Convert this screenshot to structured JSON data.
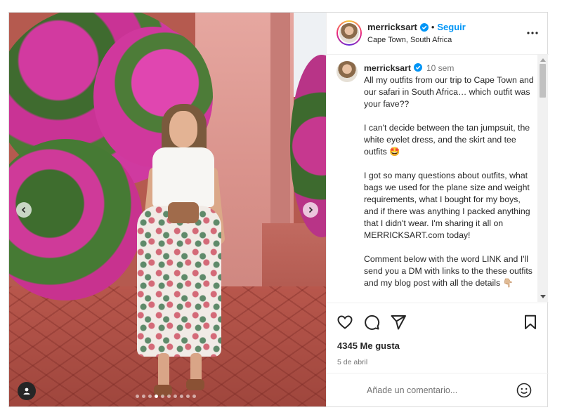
{
  "post": {
    "username": "merricksart",
    "follow_label": "Seguir",
    "separator": "•",
    "location": "Cape Town, South Africa",
    "image_count": 10,
    "active_image_index": 3
  },
  "caption": {
    "username": "merricksart",
    "time_ago": "10 sem",
    "text": "All my outfits from our trip to Cape Town and our safari in South Africa… which outfit was your fave??\n\nI can't decide between the tan jumpsuit, the white eyelet dress, and the skirt and tee outfits 🤩\n\nI got so many questions about outfits, what bags we used for the plane size and weight requirements, what I bought for my boys, and if there was anything I packed anything that I didn't wear. I'm sharing it all on MERRICKSART.com today!\n\nComment below with the word LINK and I'll send you a DM with links to the these outfits and my blog post with all the details 👇🏼"
  },
  "stats": {
    "likes": "4345 Me gusta",
    "date": "5 de abril"
  },
  "comment": {
    "placeholder": "Añade un comentario..."
  },
  "icons": {
    "verified": "verified-badge-icon",
    "more": "more-options-icon",
    "like": "heart-icon",
    "comment": "comment-icon",
    "share": "send-icon",
    "save": "bookmark-icon",
    "emoji": "emoji-icon",
    "prev": "chevron-left-icon",
    "next": "chevron-right-icon",
    "user_tag": "user-tag-icon"
  },
  "colors": {
    "accent": "#0095f6",
    "verified": "#0095f6",
    "text": "#262626",
    "secondary_text": "#737373"
  }
}
